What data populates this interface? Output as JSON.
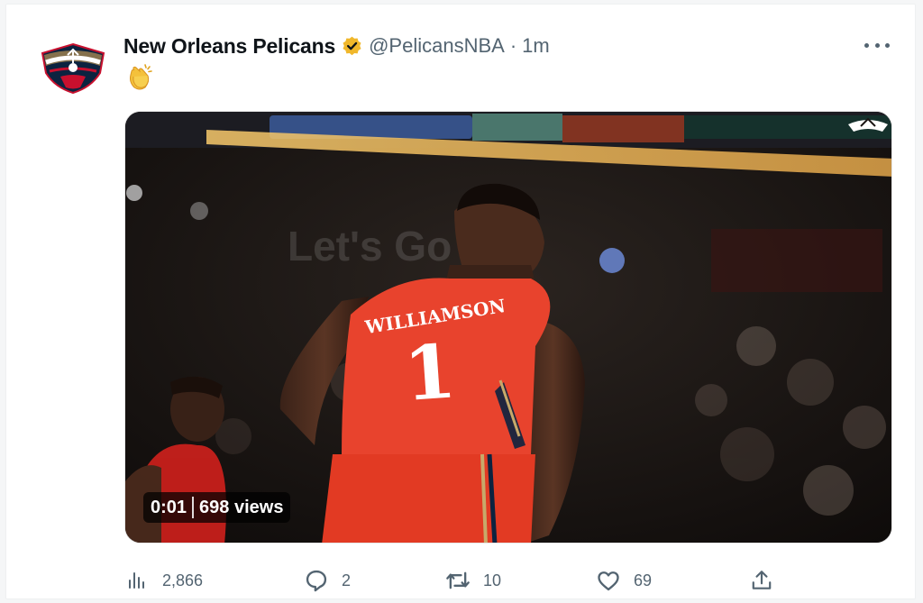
{
  "tweet": {
    "display_name": "New Orleans Pelicans",
    "handle": "@PelicansNBA",
    "separator": "·",
    "time": "1m",
    "body_emoji": "clapping-hands",
    "verified_color": "#f0b72b"
  },
  "media": {
    "timestamp": "0:01",
    "views": "698 views",
    "jersey_name": "WILLIAMSON",
    "jersey_number": "1",
    "jersey_color": "#e8432d"
  },
  "actions": {
    "views": "2,866",
    "replies": "2",
    "retweets": "10",
    "likes": "69"
  },
  "colors": {
    "secondary_text": "#536471",
    "primary_text": "#0f1419"
  }
}
